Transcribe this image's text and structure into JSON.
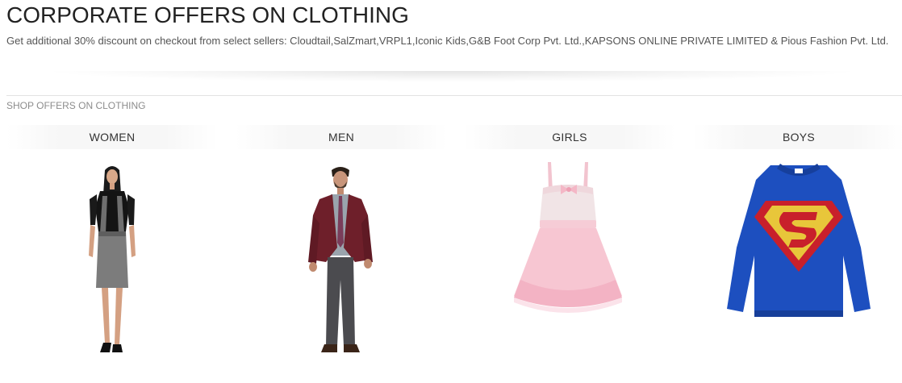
{
  "header": {
    "title": "CORPORATE OFFERS ON CLOTHING",
    "subtitle": "Get additional 30% discount on checkout from select sellers: Cloudtail,SalZmart,VRPL1,Iconic Kids,G&B Foot Corp Pvt. Ltd.,KAPSONS ONLINE PRIVATE LIMITED & Pious Fashion Pvt. Ltd."
  },
  "section": {
    "label": "SHOP OFFERS ON CLOTHING"
  },
  "categories": [
    {
      "label": "WOMEN",
      "image": "woman-in-grey-pinafore-dress"
    },
    {
      "label": "MEN",
      "image": "man-in-maroon-blazer"
    },
    {
      "label": "GIRLS",
      "image": "pink-tutu-party-dress"
    },
    {
      "label": "BOYS",
      "image": "blue-superman-sweatshirt"
    }
  ],
  "colors": {
    "title": "#222222",
    "text": "#555555",
    "muted": "#8c8c8c",
    "divider": "#e3e3e3"
  }
}
